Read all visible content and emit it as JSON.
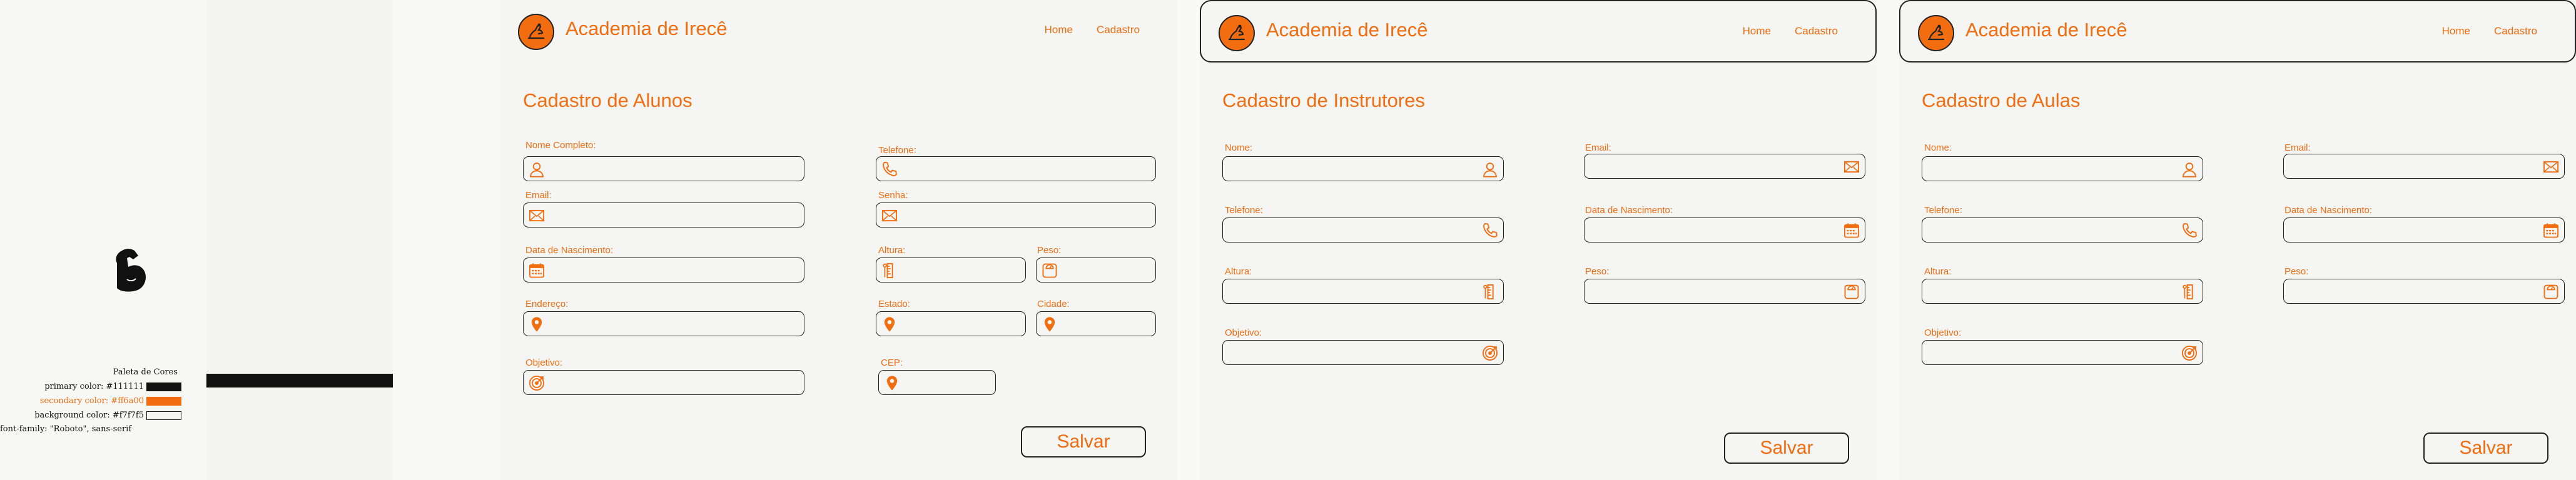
{
  "guide": {
    "palette_title": "Paleta de Cores",
    "primary": "primary color: #111111",
    "secondary": "secondary color: #ff6a00",
    "background": "background color: #f7f7f5",
    "font": "font-family: \"Roboto\", sans-serif"
  },
  "colors": {
    "primary": "#111111",
    "secondary": "#f26c10",
    "background": "#f7f7f5"
  },
  "header": {
    "brand": "Academia de Irecê",
    "nav": [
      "Home",
      "Cadastro"
    ]
  },
  "alunos": {
    "title": "Cadastro de Alunos",
    "labels": {
      "nome": "Nome Completo:",
      "telefone": "Telefone:",
      "email": "Email:",
      "senha": "Senha:",
      "nascimento": "Data de Nascimento:",
      "altura": "Altura:",
      "peso": "Peso:",
      "endereco": "Endereço:",
      "estado": "Estado:",
      "cidade": "Cidade:",
      "objetivo": "Objetivo:",
      "cep": "CEP:"
    },
    "save": "Salvar"
  },
  "instrutores": {
    "title": "Cadastro de Instrutores",
    "labels": {
      "nome": "Nome:",
      "email": "Email:",
      "telefone": "Telefone:",
      "nascimento": "Data de Nascimento:",
      "altura": "Altura:",
      "peso": "Peso:",
      "objetivo": "Objetivo:"
    },
    "save": "Salvar"
  },
  "aulas": {
    "title": "Cadastro de Aulas",
    "labels": {
      "nome": "Nome:",
      "email": "Email:",
      "telefone": "Telefone:",
      "nascimento": "Data de Nascimento:",
      "altura": "Altura:",
      "peso": "Peso:",
      "objetivo": "Objetivo:"
    },
    "save": "Salvar"
  },
  "icons": [
    "user-icon",
    "phone-icon",
    "mail-icon",
    "calendar-icon",
    "ruler-icon",
    "scale-icon",
    "map-pin-icon",
    "target-icon",
    "muscle-icon",
    "logo-icon"
  ]
}
